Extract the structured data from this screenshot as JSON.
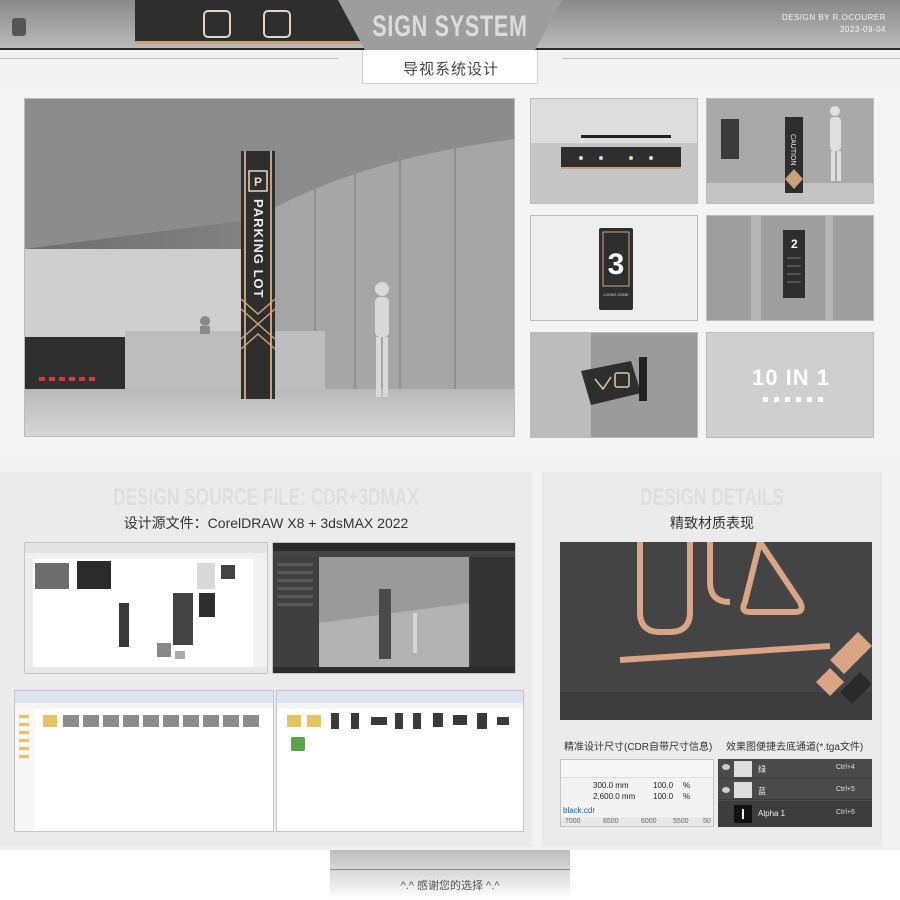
{
  "header": {
    "title": "SIGN SYSTEM",
    "subtitle": "导视系统设计",
    "credit_line1": "DESIGN BY R.OCOURER",
    "credit_line2": "2023-09-04"
  },
  "renders": {
    "main_sign_text": "PARKING LOT",
    "caution_text": "CAUTION",
    "floor_number": "3",
    "floor_caption": "LIVING ZONE",
    "small_floor": "2",
    "combo_label": "10 IN 1"
  },
  "source": {
    "ghost_title": "DESIGN SOURCE FILE: CDR+3DMAX",
    "caption": "设计源文件：CorelDRAW X8  +  3dsMAX 2022"
  },
  "details": {
    "ghost_title": "DESIGN DETAILS",
    "caption": "精致材质表现",
    "size_caption": "精准设计尺寸(CDR自带尺寸信息)",
    "channel_caption": "效果图便捷去底通道(*.tga文件)",
    "dim_width": "300.0 mm",
    "dim_height": "2,600.0 mm",
    "scale_1": "100.0",
    "scale_2": "100.0",
    "pct_1": "%",
    "pct_2": "%",
    "filename": "black.cdr",
    "ruler": [
      "7000",
      "6500",
      "6000",
      "5500"
    ],
    "ruler_end": "50",
    "channels": [
      {
        "name": "绿",
        "key": "Ctrl+4"
      },
      {
        "name": "蓝",
        "key": "Ctrl+5"
      },
      {
        "name": "Alpha 1",
        "key": "Ctrl+6"
      }
    ]
  },
  "footer": {
    "text": "^.^  感谢您的选择  ^.^"
  },
  "colors": {
    "accent_gold": "#c9a27a",
    "sign_dark": "#2e2e2e"
  }
}
